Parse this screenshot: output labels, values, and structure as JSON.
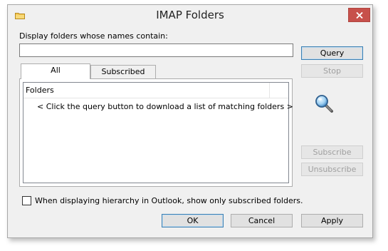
{
  "window": {
    "title": "IMAP Folders"
  },
  "filter": {
    "label": "Display folders whose names contain:",
    "value": "",
    "placeholder": ""
  },
  "tabs": [
    {
      "label": "All",
      "active": true
    },
    {
      "label": "Subscribed",
      "active": false
    }
  ],
  "folder_list": {
    "column_header": "Folders",
    "message": "< Click the query button to download a list of matching folders >"
  },
  "side_buttons": {
    "query": "Query",
    "stop": "Stop",
    "subscribe": "Subscribe",
    "unsubscribe": "Unsubscribe"
  },
  "option": {
    "label": "When displaying hierarchy in Outlook, show only subscribed folders.",
    "checked": false
  },
  "footer_buttons": {
    "ok": "OK",
    "cancel": "Cancel",
    "apply": "Apply"
  },
  "colors": {
    "close_button": "#c7504b",
    "default_button_border": "#3c7fb1",
    "dialog_background": "#f0f0f0"
  },
  "icons": {
    "title": "folder-icon",
    "close": "close-icon",
    "illustration": "magnifier-icon"
  }
}
